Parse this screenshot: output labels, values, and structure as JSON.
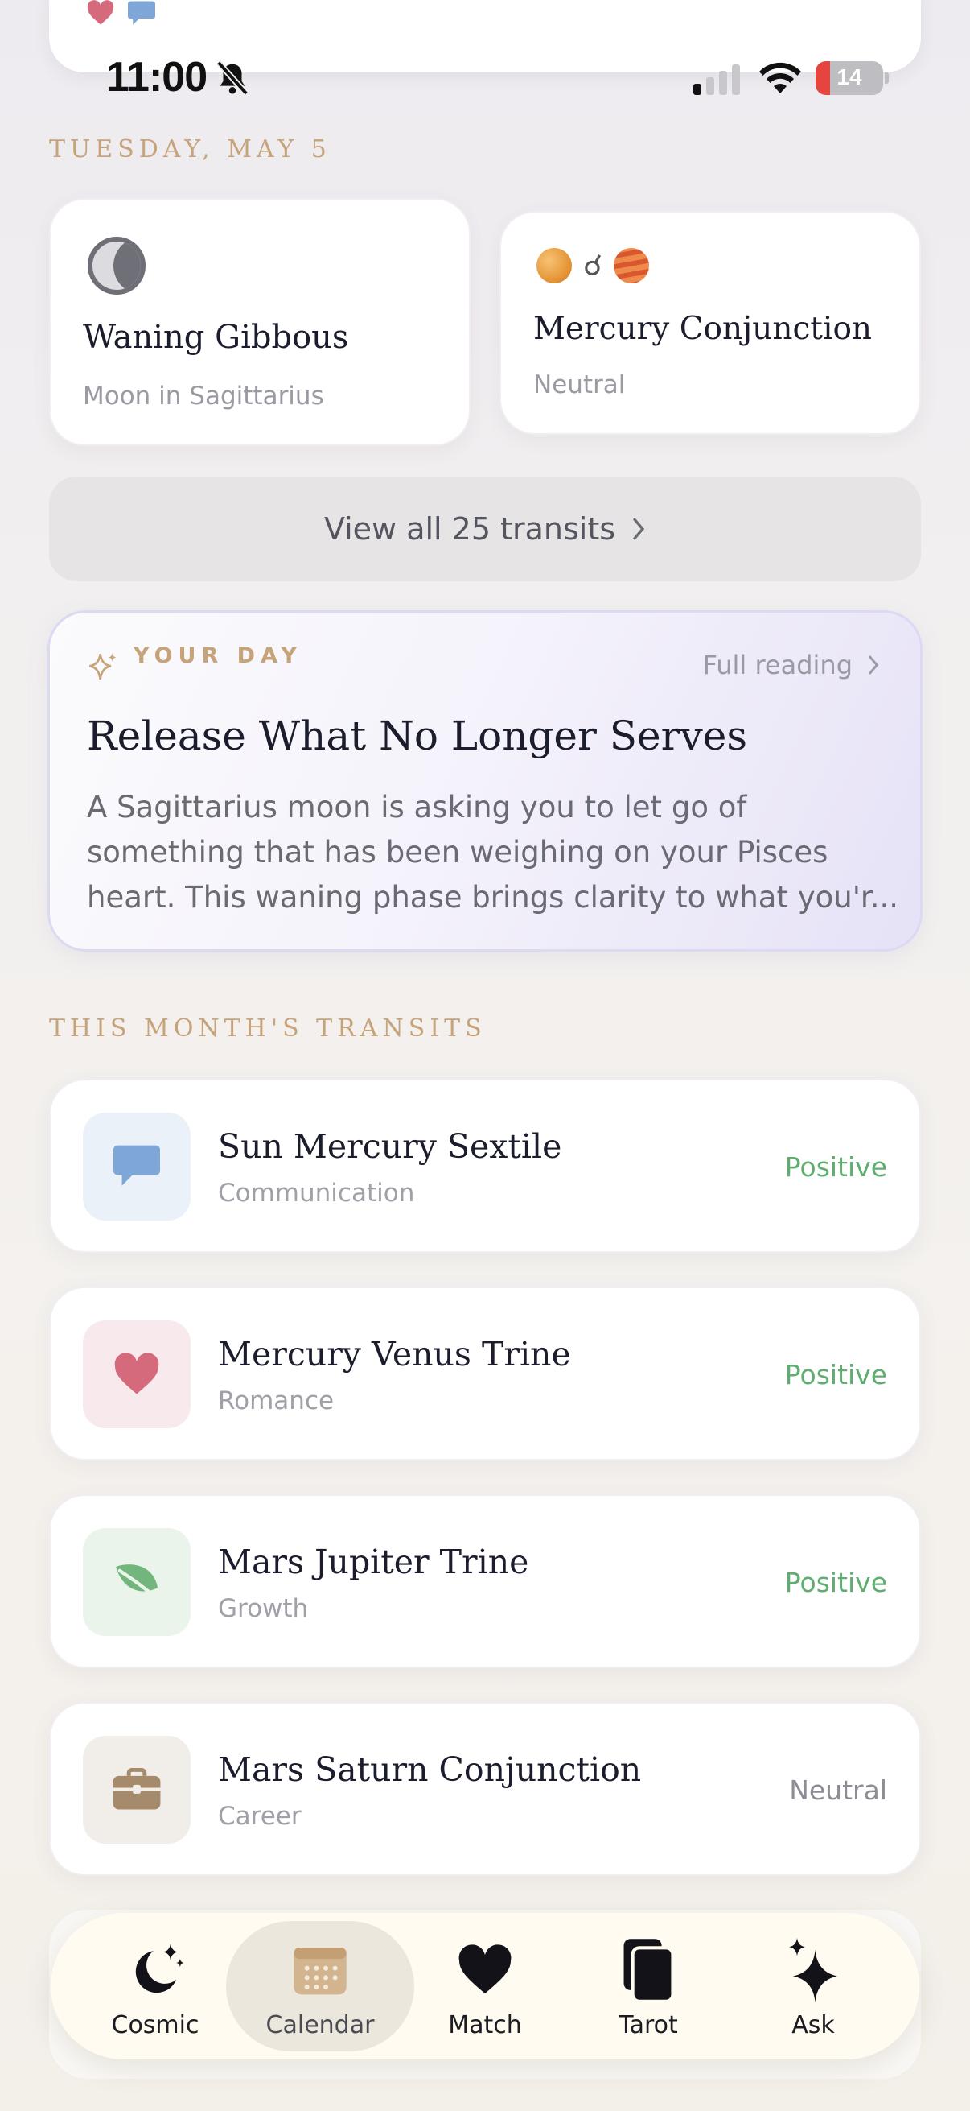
{
  "status": {
    "time": "11:00",
    "battery": "14"
  },
  "header": {
    "date": "Tuesday, May 5"
  },
  "moon": {
    "title": "Waning Gibbous",
    "subtitle": "Moon in Sagittarius"
  },
  "highlight": {
    "symbol": "☌",
    "title": "Mercury Conjunction",
    "subtitle": "Neutral"
  },
  "view_all": {
    "label": "View all 25 transits"
  },
  "your_day": {
    "label": "YOUR DAY",
    "link": "Full reading",
    "title": "Release What No Longer Serves",
    "body": "A Sagittarius moon is asking you to let go of something that has been weighing on your Pisces heart. This waning phase brings clarity to what you'r..."
  },
  "transits_section": {
    "label": "This Month's Transits"
  },
  "transits": [
    {
      "title": "Sun Mercury Sextile",
      "category": "Communication",
      "tone": "Positive",
      "icon": "chat-bubble-icon",
      "icon_bg": "#ebf1f8",
      "icon_color": "#7ea7d8"
    },
    {
      "title": "Mercury Venus Trine",
      "category": "Romance",
      "tone": "Positive",
      "icon": "heart-icon",
      "icon_bg": "#f8e9ec",
      "icon_color": "#d46a7b"
    },
    {
      "title": "Mars Jupiter Trine",
      "category": "Growth",
      "tone": "Positive",
      "icon": "leaf-icon",
      "icon_bg": "#eaf4ea",
      "icon_color": "#72b57d"
    },
    {
      "title": "Mars Saturn Conjunction",
      "category": "Career",
      "tone": "Neutral",
      "icon": "briefcase-icon",
      "icon_bg": "#f1eeea",
      "icon_color": "#a58a6c"
    }
  ],
  "tabs": [
    {
      "label": "Cosmic",
      "icon": "moon-stars-icon"
    },
    {
      "label": "Calendar",
      "icon": "calendar-icon",
      "active": true
    },
    {
      "label": "Match",
      "icon": "heart-icon"
    },
    {
      "label": "Tarot",
      "icon": "cards-icon"
    },
    {
      "label": "Ask",
      "icon": "sparkle-icon"
    }
  ],
  "colors": {
    "accent_gold": "#c7a37a",
    "positive": "#5fae70",
    "neutral": "#8d8d96"
  }
}
